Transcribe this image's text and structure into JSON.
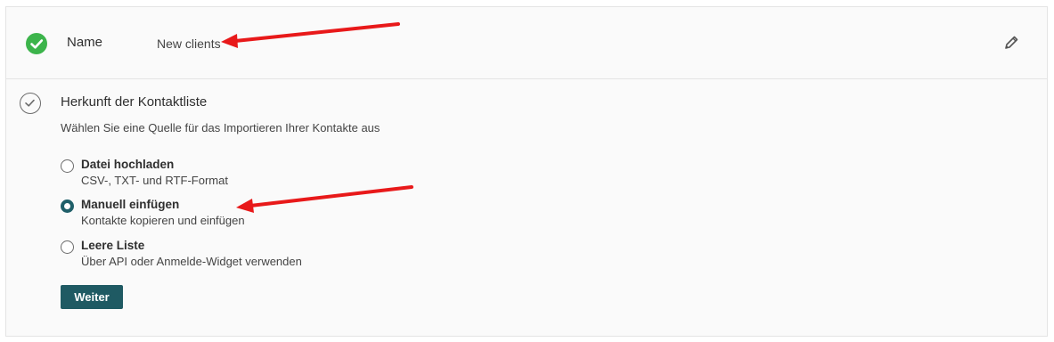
{
  "name_section": {
    "label": "Name",
    "value": "New clients",
    "status_icon": "check-circle-icon",
    "edit_icon": "pencil-icon",
    "accent": "#3cb44b"
  },
  "source_section": {
    "title": "Herkunft der Kontaktliste",
    "subtitle": "Wählen Sie eine Quelle für das Importieren Ihrer Kontakte aus",
    "options": [
      {
        "title": "Datei hochladen",
        "description": "CSV-, TXT- und RTF-Format",
        "selected": false
      },
      {
        "title": "Manuell einfügen",
        "description": "Kontakte kopieren und einfügen",
        "selected": true
      },
      {
        "title": "Leere Liste",
        "description": "Über API oder Anmelde-Widget verwenden",
        "selected": false
      }
    ],
    "next_label": "Weiter",
    "button_color": "#1f5a63"
  },
  "annotation_color": "#e8191a"
}
